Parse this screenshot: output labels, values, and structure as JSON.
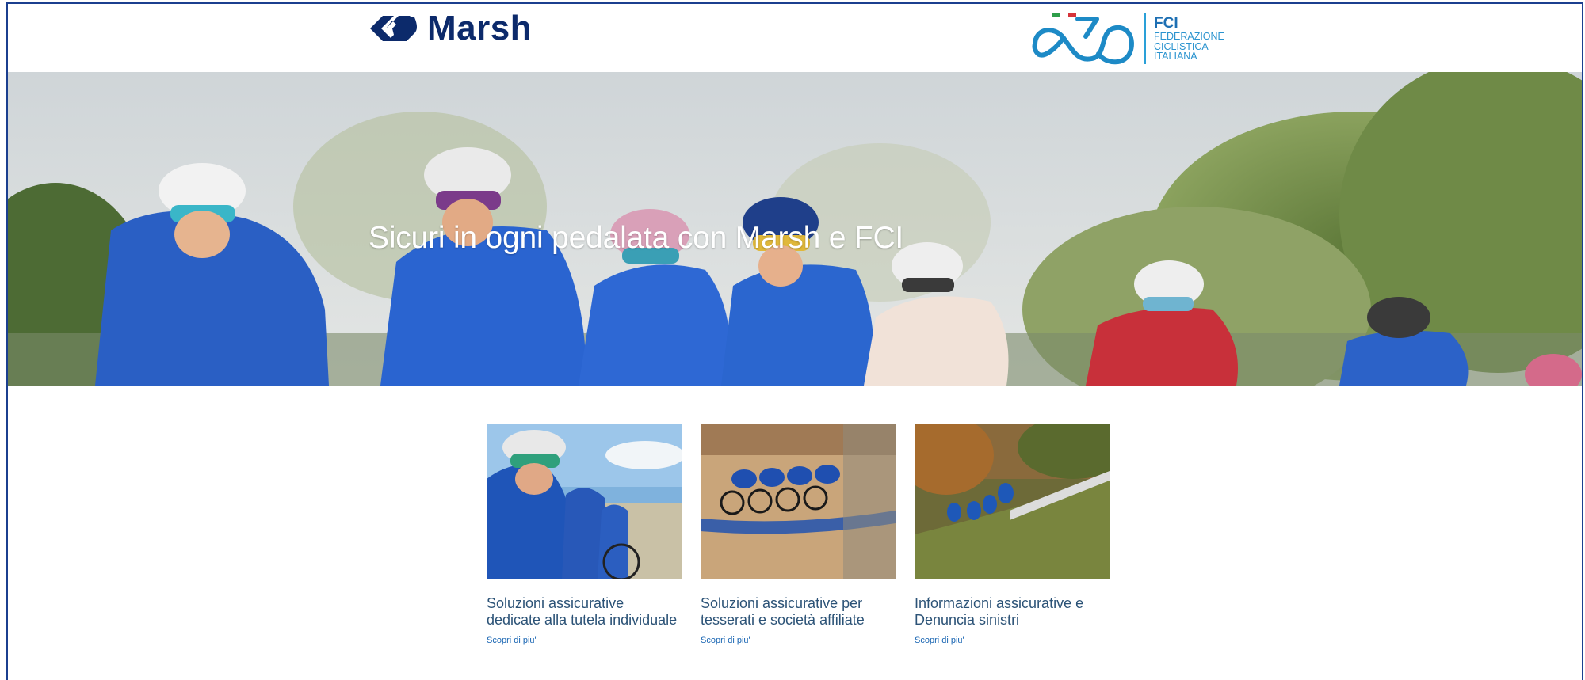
{
  "header": {
    "marsh_label": "Marsh",
    "fci_abbr": "FCI",
    "fci_line1": "FEDERAZIONE",
    "fci_line2": "CICLISTICA",
    "fci_line3": "ITALIANA"
  },
  "hero": {
    "title": "Sicuri in ogni pedalata con Marsh e FCI"
  },
  "cards": [
    {
      "title": "Soluzioni assicurative dedicate alla tutela individuale",
      "link": "Scopri di piu'"
    },
    {
      "title": "Soluzioni assicurative per tesserati e società affiliate",
      "link": "Scopri di piu'"
    },
    {
      "title": "Informazioni assicurative e Denuncia sinistri",
      "link": "Scopri di piu'"
    }
  ],
  "colors": {
    "brand_navy": "#0c2a6b",
    "fci_blue": "#1d8ac6",
    "link_blue": "#1a66b3",
    "frame_border": "#1b3f8f"
  }
}
